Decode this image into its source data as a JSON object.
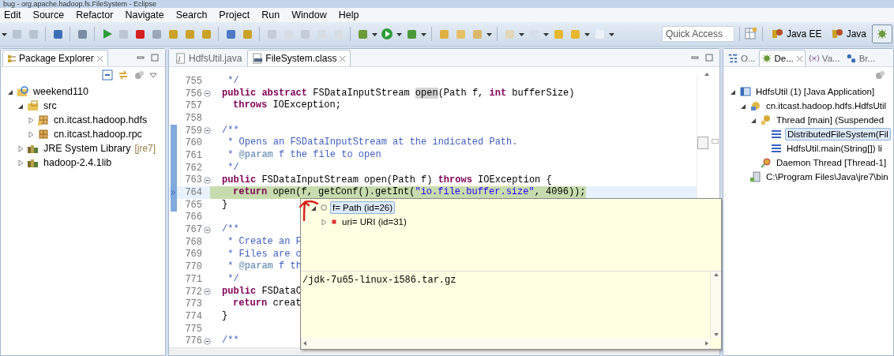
{
  "window": {
    "title": "bug - org.apache.hadoop.fs.FileSystem - Eclipse"
  },
  "menu": [
    "Edit",
    "Source",
    "Refactor",
    "Navigate",
    "Search",
    "Project",
    "Run",
    "Window",
    "Help"
  ],
  "quick_access": {
    "placeholder": "Quick Access"
  },
  "perspectives": [
    {
      "kind": "text",
      "label": "Java EE",
      "selected": false
    },
    {
      "kind": "text",
      "label": "Java",
      "selected": false
    },
    {
      "kind": "icon",
      "selected": true
    }
  ],
  "package_explorer": {
    "title": "Package Explorer",
    "tree": [
      {
        "kind": "project",
        "label": "weekend110",
        "expanded": true,
        "children": [
          {
            "kind": "source",
            "label": "src",
            "expanded": true,
            "children": [
              {
                "kind": "package",
                "label": "cn.itcast.hadoop.hdfs",
                "expanded": false
              },
              {
                "kind": "package2",
                "label": "cn.itcast.hadoop.rpc",
                "expanded": false
              }
            ]
          },
          {
            "kind": "library",
            "label": "JRE System Library",
            "decoration": "[jre7]",
            "expanded": false
          },
          {
            "kind": "library",
            "label": "hadoop-2.4.1lib",
            "expanded": false
          }
        ]
      }
    ]
  },
  "editor": {
    "tabs": [
      {
        "kind": "java",
        "label": "HdfsUtil.java",
        "selected": false
      },
      {
        "kind": "class",
        "label": "FileSystem.class",
        "selected": true
      }
    ],
    "lines": [
      {
        "number": "755",
        "tokens": [
          {
            "kind": "comment",
            "text": " */"
          }
        ]
      },
      {
        "number": "756",
        "fold": true,
        "tokens": [
          {
            "kind": "keyword",
            "text": "public abstract"
          },
          {
            "kind": "plain",
            "text": " FSDataInputStream "
          },
          {
            "kind": "occurrence",
            "text": "open"
          },
          {
            "kind": "plain",
            "text": "(Path f, "
          },
          {
            "kind": "keyword",
            "text": "int"
          },
          {
            "kind": "plain",
            "text": " bufferSize)"
          }
        ]
      },
      {
        "number": "757",
        "indented": true,
        "tokens": [
          {
            "kind": "keyword",
            "text": "throws"
          },
          {
            "kind": "plain",
            "text": " IOException;"
          }
        ]
      },
      {
        "number": "758"
      },
      {
        "number": "759",
        "fold": true,
        "ruler": true,
        "tokens": [
          {
            "kind": "comment",
            "text": "/**"
          }
        ]
      },
      {
        "number": "760",
        "ruler": true,
        "tokens": [
          {
            "kind": "comment",
            "text": " * Opens an FSDataInputStream at the indicated Path."
          }
        ]
      },
      {
        "number": "761",
        "ruler": true,
        "tokens": [
          {
            "kind": "comment",
            "text": " * "
          },
          {
            "kind": "tag",
            "text": "@param"
          },
          {
            "kind": "comment",
            "text": " f the file to open"
          }
        ]
      },
      {
        "number": "762",
        "ruler": true,
        "tokens": [
          {
            "kind": "comment",
            "text": " */"
          }
        ]
      },
      {
        "number": "763",
        "fold": true,
        "ruler": true,
        "tokens": [
          {
            "kind": "keyword",
            "text": "public"
          },
          {
            "kind": "plain",
            "text": " FSDataInputStream open(Path f) "
          },
          {
            "kind": "keyword",
            "text": "throws"
          },
          {
            "kind": "plain",
            "text": " IOException {"
          }
        ]
      },
      {
        "number": "764",
        "ruler": true,
        "current": true,
        "indented": true,
        "tokens": [
          {
            "kind": "keyword",
            "text": "return"
          },
          {
            "kind": "plain",
            "text": " open(f, getConf().getInt("
          },
          {
            "kind": "string",
            "text": "\"io.file.buffer.size\""
          },
          {
            "kind": "plain",
            "text": ", 4096));"
          }
        ]
      },
      {
        "number": "765",
        "ruler": true,
        "tokens": [
          {
            "kind": "plain",
            "text": "}"
          }
        ]
      },
      {
        "number": "766"
      },
      {
        "number": "767",
        "fold": true,
        "tokens": [
          {
            "kind": "comment",
            "text": "/**"
          }
        ]
      },
      {
        "number": "768",
        "tokens": [
          {
            "kind": "comment",
            "text": " * Create an F"
          }
        ]
      },
      {
        "number": "769",
        "tokens": [
          {
            "kind": "comment",
            "text": " * Files are o"
          }
        ]
      },
      {
        "number": "770",
        "tokens": [
          {
            "kind": "comment",
            "text": " * "
          },
          {
            "kind": "tag",
            "text": "@param"
          },
          {
            "kind": "comment",
            "text": " f th"
          }
        ]
      },
      {
        "number": "771",
        "tokens": [
          {
            "kind": "comment",
            "text": " */"
          }
        ]
      },
      {
        "number": "772",
        "fold": true,
        "tokens": [
          {
            "kind": "keyword",
            "text": "public"
          },
          {
            "kind": "plain",
            "text": " FSDataO"
          }
        ]
      },
      {
        "number": "773",
        "indented": true,
        "tokens": [
          {
            "kind": "keyword",
            "text": "return"
          },
          {
            "kind": "plain",
            "text": " creat"
          }
        ]
      },
      {
        "number": "774",
        "tokens": [
          {
            "kind": "plain",
            "text": "}"
          }
        ]
      },
      {
        "number": "775"
      },
      {
        "number": "776",
        "fold": true,
        "tokens": [
          {
            "kind": "comment",
            "text": "/**"
          }
        ]
      }
    ],
    "hover": {
      "tree": [
        {
          "kind": "object",
          "label": "f= Path  (id=26)",
          "selected": true,
          "expanded": true,
          "children": [
            {
              "kind": "field",
              "label": "uri= URI  (id=31)",
              "selected": false,
              "expanded": false
            }
          ]
        }
      ],
      "detail": "/jdk-7u65-linux-i586.tar.gz"
    }
  },
  "debug_view": {
    "tabs": [
      {
        "kind": "outline",
        "label": "O...",
        "selected": false
      },
      {
        "kind": "debug",
        "label": "De...",
        "selected": true
      },
      {
        "kind": "variables",
        "label": "Va...",
        "selected": false
      },
      {
        "kind": "breakpoints",
        "label": "Br...",
        "selected": false
      }
    ],
    "tree": [
      {
        "kind": "app",
        "label": "HdfsUtil (1) [Java Application]",
        "selected": false,
        "expanded": true,
        "children": [
          {
            "kind": "target",
            "label": "cn.itcast.hadoop.hdfs.HdfsUtil",
            "selected": false,
            "expanded": true,
            "children": [
              {
                "kind": "thread",
                "label": "Thread [main] (Suspended",
                "selected": false,
                "expanded": true,
                "children": [
                  {
                    "kind": "frame",
                    "label": "DistributedFileSystem(Fil",
                    "selected": true
                  },
                  {
                    "kind": "frame",
                    "label": "HdfsUtil.main(String[]) li",
                    "selected": false
                  }
                ]
              },
              {
                "kind": "daemon",
                "label": "Daemon Thread [Thread-1]",
                "selected": false
              }
            ]
          },
          {
            "kind": "process",
            "label": "C:\\Program Files\\Java\\jre7\\bin",
            "selected": false
          }
        ]
      }
    ]
  }
}
